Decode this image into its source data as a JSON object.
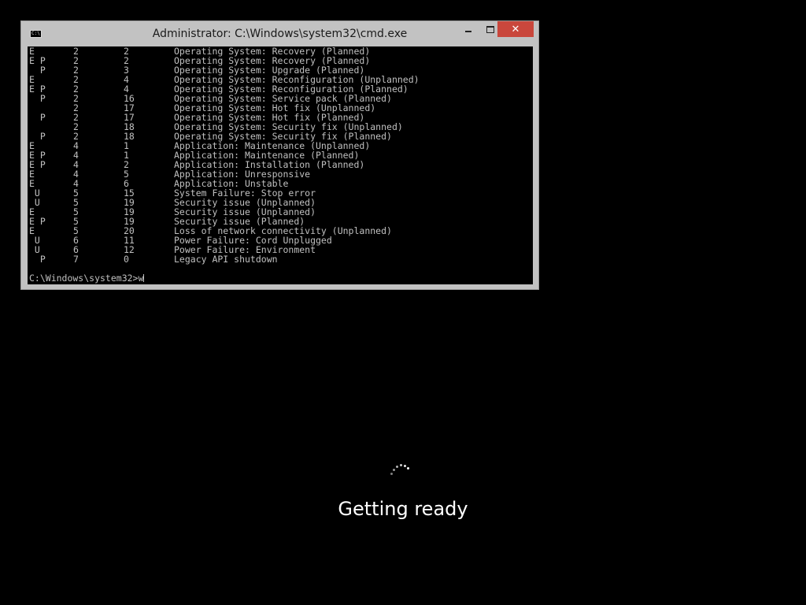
{
  "window": {
    "title": "Administrator: C:\\Windows\\system32\\cmd.exe",
    "icon": "cmd-icon",
    "icon_glyph": "C:\\",
    "close_glyph": "✕"
  },
  "console": {
    "rows": [
      {
        "flags": "E",
        "major": "2",
        "minor": "2",
        "reason": "Operating System: Recovery (Planned)"
      },
      {
        "flags": "E P",
        "major": "2",
        "minor": "2",
        "reason": "Operating System: Recovery (Planned)"
      },
      {
        "flags": "  P",
        "major": "2",
        "minor": "3",
        "reason": "Operating System: Upgrade (Planned)"
      },
      {
        "flags": "E",
        "major": "2",
        "minor": "4",
        "reason": "Operating System: Reconfiguration (Unplanned)"
      },
      {
        "flags": "E P",
        "major": "2",
        "minor": "4",
        "reason": "Operating System: Reconfiguration (Planned)"
      },
      {
        "flags": "  P",
        "major": "2",
        "minor": "16",
        "reason": "Operating System: Service pack (Planned)"
      },
      {
        "flags": "",
        "major": "2",
        "minor": "17",
        "reason": "Operating System: Hot fix (Unplanned)"
      },
      {
        "flags": "  P",
        "major": "2",
        "minor": "17",
        "reason": "Operating System: Hot fix (Planned)"
      },
      {
        "flags": "",
        "major": "2",
        "minor": "18",
        "reason": "Operating System: Security fix (Unplanned)"
      },
      {
        "flags": "  P",
        "major": "2",
        "minor": "18",
        "reason": "Operating System: Security fix (Planned)"
      },
      {
        "flags": "E",
        "major": "4",
        "minor": "1",
        "reason": "Application: Maintenance (Unplanned)"
      },
      {
        "flags": "E P",
        "major": "4",
        "minor": "1",
        "reason": "Application: Maintenance (Planned)"
      },
      {
        "flags": "E P",
        "major": "4",
        "minor": "2",
        "reason": "Application: Installation (Planned)"
      },
      {
        "flags": "E",
        "major": "4",
        "minor": "5",
        "reason": "Application: Unresponsive"
      },
      {
        "flags": "E",
        "major": "4",
        "minor": "6",
        "reason": "Application: Unstable"
      },
      {
        "flags": " U",
        "major": "5",
        "minor": "15",
        "reason": "System Failure: Stop error"
      },
      {
        "flags": " U",
        "major": "5",
        "minor": "19",
        "reason": "Security issue (Unplanned)"
      },
      {
        "flags": "E",
        "major": "5",
        "minor": "19",
        "reason": "Security issue (Unplanned)"
      },
      {
        "flags": "E P",
        "major": "5",
        "minor": "19",
        "reason": "Security issue (Planned)"
      },
      {
        "flags": "E",
        "major": "5",
        "minor": "20",
        "reason": "Loss of network connectivity (Unplanned)"
      },
      {
        "flags": " U",
        "major": "6",
        "minor": "11",
        "reason": "Power Failure: Cord Unplugged"
      },
      {
        "flags": " U",
        "major": "6",
        "minor": "12",
        "reason": "Power Failure: Environment"
      },
      {
        "flags": "  P",
        "major": "7",
        "minor": "0",
        "reason": "Legacy API shutdown"
      }
    ],
    "prompt": "C:\\Windows\\system32>",
    "input": "w"
  },
  "status": {
    "message": "Getting ready",
    "spinner_icon": "loading-spinner-icon"
  },
  "colors": {
    "background": "#000000",
    "console_text": "#c0c0c0",
    "close_button": "#c9473c",
    "frame": "#c2c2c2"
  }
}
